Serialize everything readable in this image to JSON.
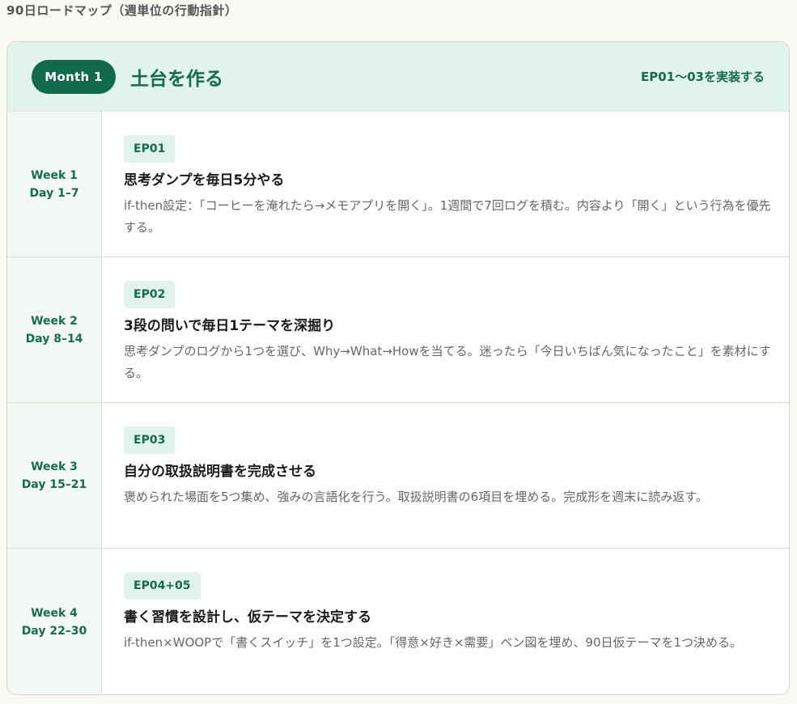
{
  "page": {
    "heading": "90日ロードマップ（週単位の行動指針）"
  },
  "month": {
    "badge": "Month 1",
    "title": "土台を作る",
    "scope": "EP01〜03を実装する"
  },
  "weeks": [
    {
      "week": "Week 1",
      "days": "Day 1–7",
      "tag": "EP01",
      "title": "思考ダンプを毎日5分やる",
      "desc": "if-then設定：「コーヒーを淹れたら→メモアプリを開く」。1週間で7回ログを積む。内容より「開く」という行為を優先する。"
    },
    {
      "week": "Week 2",
      "days": "Day 8–14",
      "tag": "EP02",
      "title": "3段の問いで毎日1テーマを深掘り",
      "desc": "思考ダンプのログから1つを選び、Why→What→Howを当てる。迷ったら「今日いちばん気になったこと」を素材にする。"
    },
    {
      "week": "Week 3",
      "days": "Day 15–21",
      "tag": "EP03",
      "title": "自分の取扱説明書を完成させる",
      "desc": "褒められた場面を5つ集め、強みの言語化を行う。取扱説明書の6項目を埋める。完成形を週末に読み返す。"
    },
    {
      "week": "Week 4",
      "days": "Day 22–30",
      "tag": "EP04+05",
      "title": "書く習慣を設計し、仮テーマを決定する",
      "desc": "if-then×WOOPで「書くスイッチ」を1つ設定。「得意×好き×需要」ベン図を埋め、90日仮テーマを1つ決める。"
    }
  ]
}
